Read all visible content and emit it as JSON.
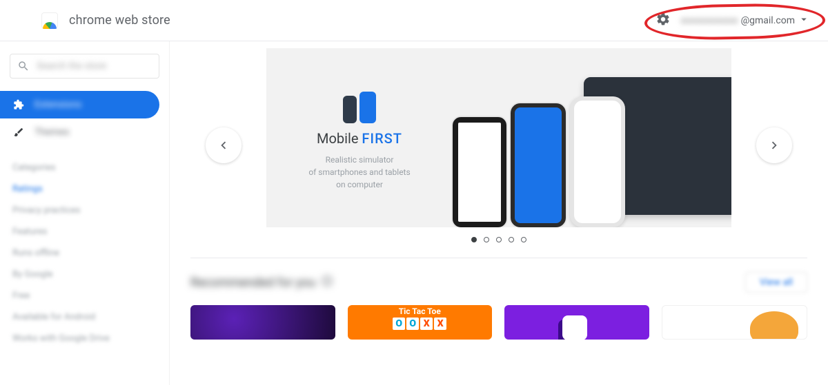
{
  "header": {
    "title": "chrome web store",
    "email_suffix": "@gmail.com"
  },
  "sidebar": {
    "search_placeholder": "Search the store",
    "nav": [
      {
        "label": "Extensions",
        "active": true
      },
      {
        "label": "Themes",
        "active": false
      }
    ],
    "filters": [
      "Categories",
      "Ratings",
      "Privacy practices",
      "Features",
      "Runs offline",
      "By Google",
      "Free",
      "Available for Android",
      "Works with Google Drive"
    ]
  },
  "carousel": {
    "slide": {
      "title_a": "Mobile ",
      "title_b": "FIRST",
      "sub1": "Realistic simulator",
      "sub2": "of smartphones and tablets",
      "sub3": "on computer"
    },
    "dot_count": 5,
    "active_dot": 0
  },
  "section": {
    "title": "Recommended for you",
    "view_all": "View all"
  },
  "tictactoe": {
    "title": "Tic Tac Toe",
    "cells": [
      "O",
      "O",
      "X",
      "X"
    ]
  }
}
